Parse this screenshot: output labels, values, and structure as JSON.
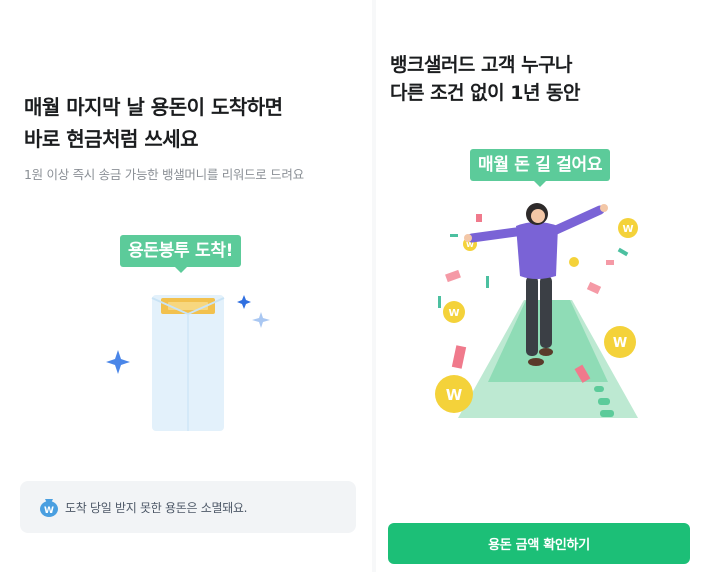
{
  "left": {
    "title_line1": "매월 마지막 날 용돈이 도착하면",
    "title_line2": "바로 현금처럼 쓰세요",
    "subtitle": "1원 이상 즉시 송금 가능한 뱅샐머니를 리워드로 드려요",
    "bubble": "용돈봉투 도착!",
    "notice_text": "도착 당일 받지 못한 용돈은 소멸돼요.",
    "notice_icon_letter": "W"
  },
  "right": {
    "title_line1": "뱅크샐러드 고객 누구나",
    "title_line2": "다른 조건 없이 1년 동안",
    "bubble": "매월 돈 길 걸어요",
    "cta_label": "용돈 금액 확인하기",
    "coin_letter": "W"
  },
  "colors": {
    "brand_green": "#1cbf77",
    "bubble_green": "#5ccb9a",
    "coin_yellow": "#f4d23a",
    "sparkle_blue": "#4a86e8",
    "path_green": "#8fdcb6",
    "shirt_purple": "#7a63d6"
  }
}
